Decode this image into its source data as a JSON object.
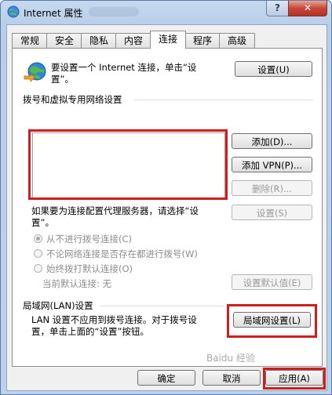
{
  "window": {
    "title": "Internet 属性",
    "help_label": "?",
    "close_label": "✕"
  },
  "tabs": [
    {
      "label": "常规"
    },
    {
      "label": "安全"
    },
    {
      "label": "隐私"
    },
    {
      "label": "内容"
    },
    {
      "label": "连接",
      "active": true
    },
    {
      "label": "程序"
    },
    {
      "label": "高级"
    }
  ],
  "connections": {
    "intro_line1": "要设置一个 Internet 连接，单击“设",
    "intro_line2": "置”。",
    "setup_button": "设置(U)",
    "dialup_section": "拨号和虚拟专用网络设置",
    "add_button": "添加(D)...",
    "add_vpn_button": "添加 VPN(P)...",
    "remove_button": "删除(R)...",
    "proxy_line1": "如果要为连接配置代理服务器，请选择“设",
    "proxy_line2": "置”。",
    "settings_button": "设置(S)",
    "radio_never": "从不进行拨号连接(C)",
    "radio_when_none": "不论网络连接是否存在都进行拨号(W)",
    "radio_always": "始终拨打默认连接(O)",
    "current_default": "当前默认连接: 无",
    "set_default_button": "设置默认值(E)",
    "lan_section": "局域网(LAN)设置",
    "lan_line1": "LAN 设置不应用到拨号连接。对于拨号设",
    "lan_line2": "置，单击上面的“设置”按钮。",
    "lan_button": "局域网设置(L)"
  },
  "footer": {
    "ok_button": "确定",
    "cancel_button": "取消",
    "apply_button": "应用(A)"
  },
  "watermark": "Baidu 经验",
  "colors": {
    "highlight": "#d11d1d",
    "title_bar": "#c6d9ef"
  }
}
